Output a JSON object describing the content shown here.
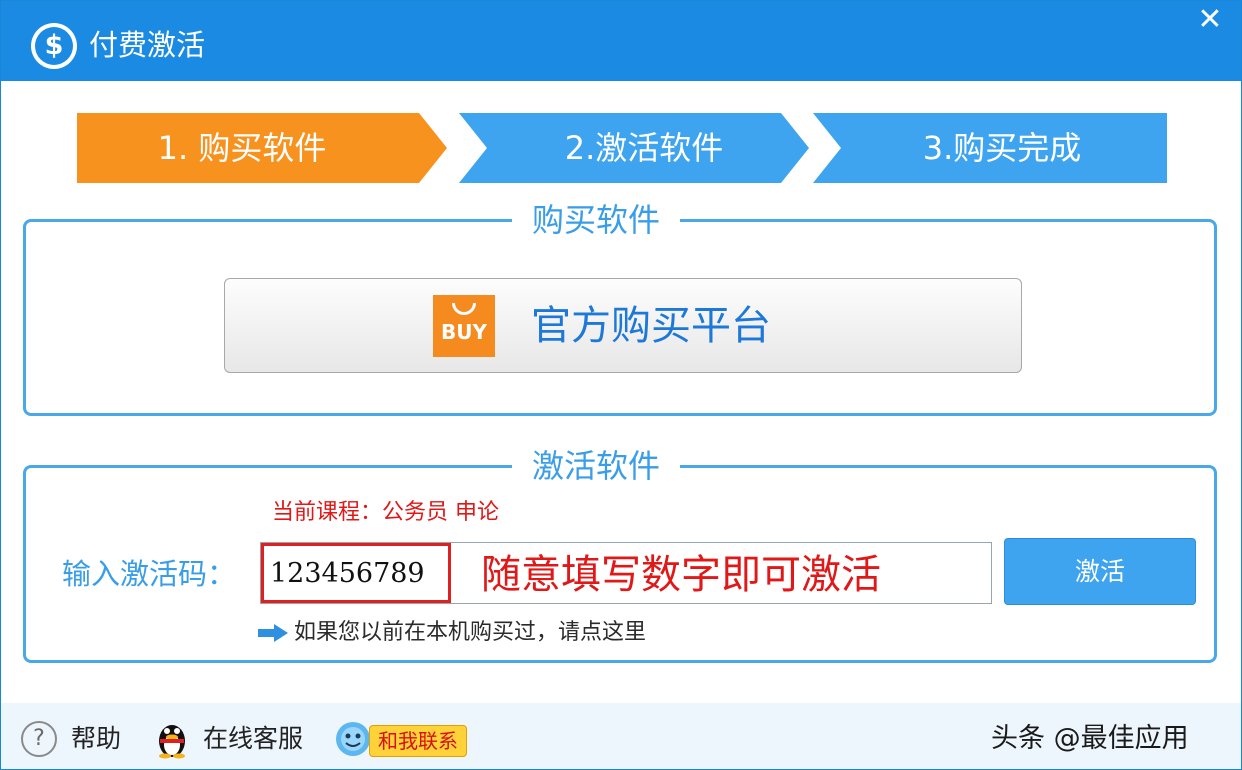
{
  "window": {
    "title": "付费激活",
    "title_icon": "dollar-icon",
    "close_glyph": "✕"
  },
  "steps": [
    {
      "label": "1. 购买软件",
      "state": "active",
      "color": "#f7921e"
    },
    {
      "label": "2.激活软件",
      "state": "pending",
      "color": "#3fa4ef"
    },
    {
      "label": "3.购买完成",
      "state": "pending",
      "color": "#3fa4ef"
    }
  ],
  "purchase": {
    "legend": "购买软件",
    "button_label": "官方购买平台",
    "buy_icon_text": "BUY"
  },
  "activation": {
    "legend": "激活软件",
    "course_text": "当前课程：公务员  申论",
    "code_label": "输入激活码：",
    "code_value": "123456789",
    "hint_text": "随意填写数字即可激活",
    "activate_button": "激活",
    "prev_purchase_link": "如果您以前在本机购买过，请点这里"
  },
  "footer": {
    "help": "帮助",
    "online_service": "在线客服",
    "contact_badge": "和我联系",
    "watermark": "头条 @最佳应用"
  },
  "colors": {
    "titlebar": "#1b8ae3",
    "accent_orange": "#f7921e",
    "accent_blue": "#3fa4ef",
    "alert_red": "#e01818"
  }
}
